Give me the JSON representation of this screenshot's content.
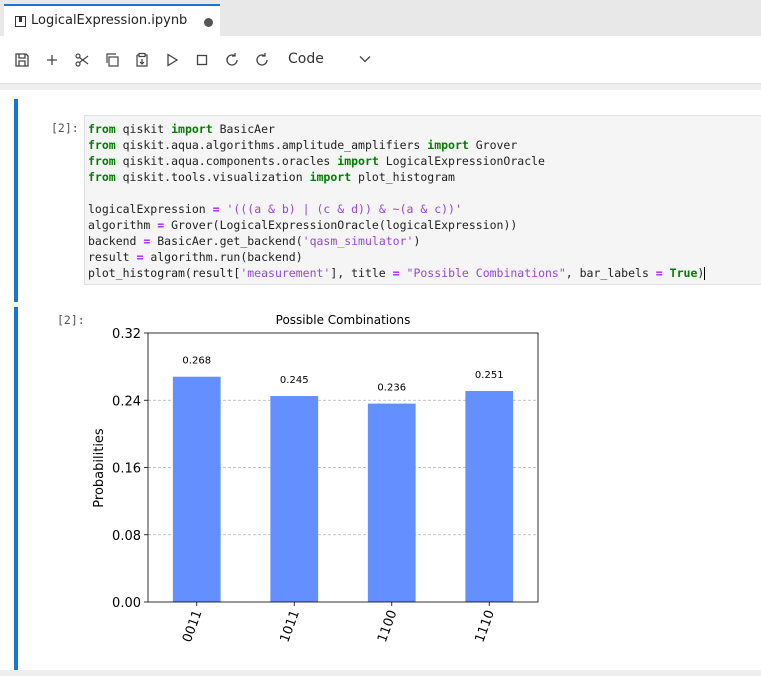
{
  "tab": {
    "title": "LogicalExpression.ipynb"
  },
  "toolbar": {
    "cell_type": "Code"
  },
  "input_cell": {
    "prompt": "[2]:",
    "lines": [
      [
        [
          "kw",
          "from"
        ],
        [
          "t",
          " qiskit "
        ],
        [
          "kw",
          "import"
        ],
        [
          "t",
          " BasicAer"
        ]
      ],
      [
        [
          "kw",
          "from"
        ],
        [
          "t",
          " qiskit.aqua.algorithms.amplitude_amplifiers "
        ],
        [
          "kw",
          "import"
        ],
        [
          "t",
          " Grover"
        ]
      ],
      [
        [
          "kw",
          "from"
        ],
        [
          "t",
          " qiskit.aqua.components.oracles "
        ],
        [
          "kw",
          "import"
        ],
        [
          "t",
          " LogicalExpressionOracle"
        ]
      ],
      [
        [
          "kw",
          "from"
        ],
        [
          "t",
          " qiskit.tools.visualization "
        ],
        [
          "kw",
          "import"
        ],
        [
          "t",
          " plot_histogram"
        ]
      ],
      [],
      [
        [
          "t",
          "logicalExpression "
        ],
        [
          "op",
          "="
        ],
        [
          "t",
          " "
        ],
        [
          "str",
          "'(((a & b) | (c & d)) & ~(a & c))'"
        ]
      ],
      [
        [
          "t",
          "algorithm "
        ],
        [
          "op",
          "="
        ],
        [
          "t",
          " Grover(LogicalExpressionOracle(logicalExpression))"
        ]
      ],
      [
        [
          "t",
          "backend "
        ],
        [
          "op",
          "="
        ],
        [
          "t",
          " BasicAer.get_backend("
        ],
        [
          "str",
          "'qasm_simulator'"
        ],
        [
          "t",
          ")"
        ]
      ],
      [
        [
          "t",
          "result "
        ],
        [
          "op",
          "="
        ],
        [
          "t",
          " algorithm.run(backend)"
        ]
      ],
      [
        [
          "t",
          "plot_histogram(result["
        ],
        [
          "str",
          "'measurement'"
        ],
        [
          "t",
          "], title "
        ],
        [
          "op",
          "="
        ],
        [
          "t",
          " "
        ],
        [
          "str",
          "\"Possible Combinations\""
        ],
        [
          "t",
          ", bar_labels "
        ],
        [
          "op",
          "="
        ],
        [
          "t",
          " "
        ],
        [
          "kw",
          "True"
        ],
        [
          "t",
          ")"
        ]
      ]
    ]
  },
  "output_cell": {
    "prompt": "[2]:"
  },
  "chart_data": {
    "type": "bar",
    "title": "Possible Combinations",
    "ylabel": "Probabilities",
    "xlabel": "",
    "categories": [
      "0011",
      "1011",
      "1100",
      "1110"
    ],
    "values": [
      0.268,
      0.245,
      0.236,
      0.251
    ],
    "value_labels": [
      "0.268",
      "0.245",
      "0.236",
      "0.251"
    ],
    "ylim": [
      0,
      0.32
    ],
    "yticks": [
      0.0,
      0.08,
      0.16,
      0.24,
      0.32
    ],
    "ytick_labels": [
      "0.00",
      "0.08",
      "0.16",
      "0.24",
      "0.32"
    ],
    "bar_color": "#648fff",
    "grid": "horizontal dashed"
  }
}
